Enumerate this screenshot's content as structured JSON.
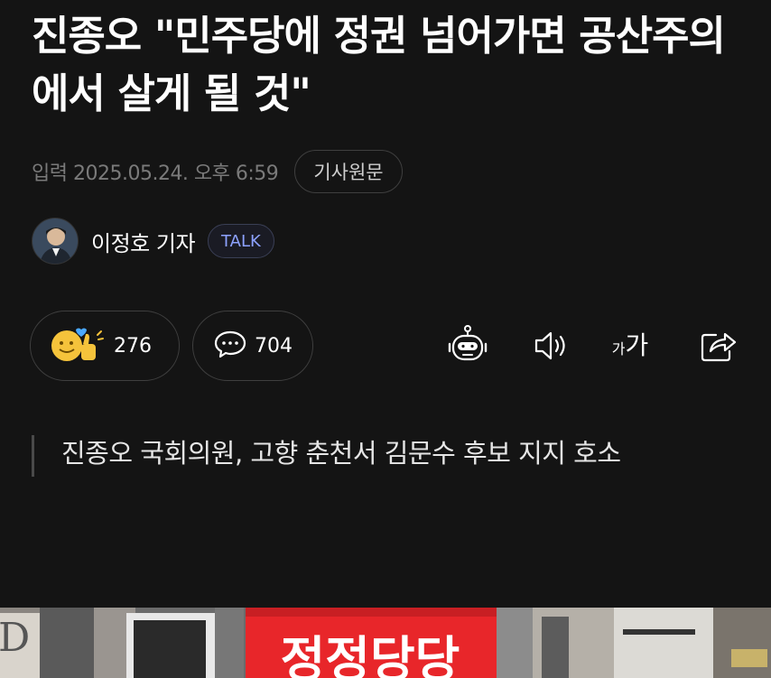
{
  "article": {
    "headline": "진종오 \"민주당에 정권 넘어가면 공산주의에서 살게 될 것\"",
    "published": "입력 2025.05.24. 오후 6:59",
    "original_label": "기사원문"
  },
  "author": {
    "name": "이정호 기자",
    "talk_label": "TALK"
  },
  "actions": {
    "reaction_count": "276",
    "comment_count": "704",
    "font_size_small": "가",
    "font_size_large": "가"
  },
  "summary": {
    "text": "진종오 국회의원, 고향 춘천서 김문수 후보 지지 호소"
  },
  "photo": {
    "sign_text": "정정당당",
    "shop_letter": "D"
  },
  "colors": {
    "background": "#141414",
    "muted_text": "#7a7a7a",
    "talk_accent": "#8da2ff",
    "reaction_yellow": "#f5c33b",
    "sign_red": "#e8262a"
  },
  "icons": {
    "reaction": "smile-thumbs-icon",
    "comment": "speech-bubble-icon",
    "summary_bot": "robot-icon",
    "listen": "speaker-icon",
    "font_size": "font-size-icon",
    "share": "share-icon"
  }
}
